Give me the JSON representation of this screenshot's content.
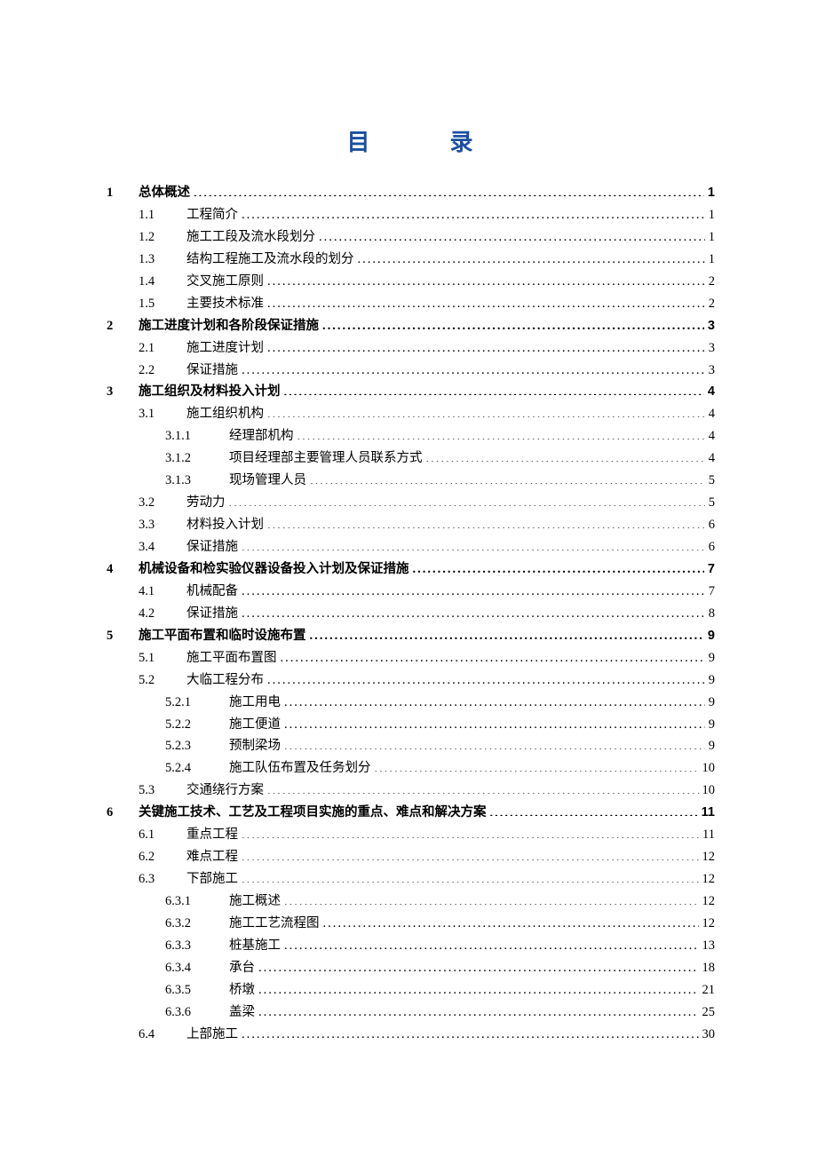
{
  "title_left": "目",
  "title_right": "录",
  "entries": [
    {
      "level": 1,
      "bold": true,
      "num": "1",
      "label": "总体概述",
      "page": "1"
    },
    {
      "level": 2,
      "num": "1.1",
      "label": "工程简介",
      "page": "1"
    },
    {
      "level": 2,
      "num": "1.2",
      "label": "施工工段及流水段划分",
      "page": "1"
    },
    {
      "level": 2,
      "num": "1.3",
      "label": "结构工程施工及流水段的划分",
      "page": "1"
    },
    {
      "level": 2,
      "num": "1.4",
      "label": "交叉施工原则",
      "page": "2"
    },
    {
      "level": 2,
      "num": "1.5",
      "label": "主要技术标准",
      "page": "2"
    },
    {
      "level": 1,
      "bold": true,
      "num": "2",
      "label": "施工进度计划和各阶段保证措施",
      "page": "3"
    },
    {
      "level": 2,
      "num": "2.1",
      "label": "施工进度计划",
      "page": "3"
    },
    {
      "level": 2,
      "num": "2.2",
      "label": "保证措施",
      "page": "3"
    },
    {
      "level": 1,
      "bold": true,
      "num": "3",
      "label": "施工组织及材料投入计划",
      "page": "4"
    },
    {
      "level": 2,
      "num": "3.1",
      "label": "施工组织机构",
      "page": "4"
    },
    {
      "level": 3,
      "num": "3.1.1",
      "label": "经理部机构",
      "page": "4"
    },
    {
      "level": 3,
      "num": "3.1.2",
      "label": "项目经理部主要管理人员联系方式",
      "page": "4"
    },
    {
      "level": 3,
      "num": "3.1.3",
      "label": "现场管理人员",
      "page": "5"
    },
    {
      "level": 2,
      "num": "3.2",
      "label": "劳动力",
      "page": "5"
    },
    {
      "level": 2,
      "num": "3.3",
      "label": "材料投入计划",
      "page": "6"
    },
    {
      "level": 2,
      "num": "3.4",
      "label": "保证措施",
      "page": "6"
    },
    {
      "level": 1,
      "bold": true,
      "num": "4",
      "label": "机械设备和检实验仪器设备投入计划及保证措施",
      "page": "7"
    },
    {
      "level": 2,
      "num": "4.1",
      "label": "机械配备",
      "page": "7"
    },
    {
      "level": 2,
      "num": "4.2",
      "label": "保证措施",
      "page": "8"
    },
    {
      "level": 1,
      "bold": true,
      "num": "5",
      "label": "施工平面布置和临时设施布置",
      "page": "9"
    },
    {
      "level": 2,
      "num": "5.1",
      "label": "施工平面布置图",
      "page": "9"
    },
    {
      "level": 2,
      "num": "5.2",
      "label": "大临工程分布",
      "page": "9"
    },
    {
      "level": 3,
      "num": "5.2.1",
      "label": "施工用电",
      "page": "9"
    },
    {
      "level": 3,
      "num": "5.2.2",
      "label": "施工便道",
      "page": "9"
    },
    {
      "level": 3,
      "num": "5.2.3",
      "label": "预制梁场",
      "page": "9"
    },
    {
      "level": 3,
      "num": "5.2.4",
      "label": "施工队伍布置及任务划分",
      "page": "10"
    },
    {
      "level": 2,
      "num": "5.3",
      "label": "交通绕行方案",
      "page": "10"
    },
    {
      "level": 1,
      "bold": true,
      "num": "6",
      "label": "关键施工技术、工艺及工程项目实施的重点、难点和解决方案",
      "page": "11"
    },
    {
      "level": 2,
      "num": "6.1",
      "label": "重点工程",
      "page": "11"
    },
    {
      "level": 2,
      "num": "6.2",
      "label": "难点工程",
      "page": "12"
    },
    {
      "level": 2,
      "num": "6.3",
      "label": "下部施工",
      "page": "12"
    },
    {
      "level": 3,
      "num": "6.3.1",
      "label": "施工概述",
      "page": "12"
    },
    {
      "level": 3,
      "num": "6.3.2",
      "label": "施工工艺流程图",
      "page": "12"
    },
    {
      "level": 3,
      "num": "6.3.3",
      "label": "桩基施工",
      "page": "13"
    },
    {
      "level": 3,
      "num": "6.3.4",
      "label": "承台",
      "page": "18"
    },
    {
      "level": 3,
      "num": "6.3.5",
      "label": "桥墩",
      "page": "21"
    },
    {
      "level": 3,
      "num": "6.3.6",
      "label": "盖梁",
      "page": "25"
    },
    {
      "level": 2,
      "num": "6.4",
      "label": "上部施工",
      "page": "30"
    }
  ]
}
